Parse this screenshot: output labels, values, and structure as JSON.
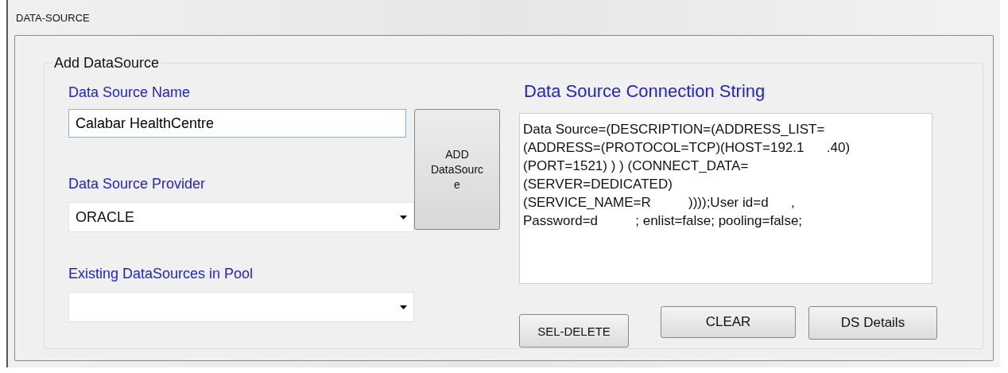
{
  "window": {
    "title": "DATA-SOURCE"
  },
  "group": {
    "title": "Add DataSource"
  },
  "name_field": {
    "label": "Data Source Name",
    "value": "Calabar HealthCentre"
  },
  "provider_field": {
    "label": "Data Source Provider",
    "value": "ORACLE"
  },
  "pool_field": {
    "label": "Existing DataSources in Pool"
  },
  "add_button": {
    "lines": [
      "ADD",
      "DataSourc",
      "e"
    ]
  },
  "connection": {
    "title": "Data Source Connection String",
    "lines": [
      "Data Source=(DESCRIPTION=(ADDRESS_LIST=",
      "(ADDRESS=(PROTOCOL=TCP)(HOST=192.1      .40)",
      "(PORT=1521) ) ) (CONNECT_DATA=",
      "(SERVER=DEDICATED)",
      "(SERVICE_NAME=R          ))));User id=d      ,",
      "Password=d          ; enlist=false; pooling=false;"
    ]
  },
  "buttons": [
    {
      "label": "SEL-DELETE"
    },
    {
      "label": "CLEAR"
    },
    {
      "label": "DS Details"
    }
  ]
}
